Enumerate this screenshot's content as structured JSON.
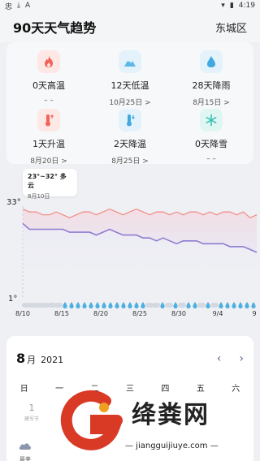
{
  "status": {
    "time": "4:19"
  },
  "header": {
    "title": "90天天气趋势",
    "city": "东城区"
  },
  "stats": [
    {
      "label": "0天高温",
      "date": "– –",
      "icon": "flame-icon",
      "color": "#f0645a",
      "bg": "#fde8e6"
    },
    {
      "label": "12天低温",
      "date": "10月25日 >",
      "icon": "snow-mountain-icon",
      "color": "#5db7e8",
      "bg": "#e3f2fb"
    },
    {
      "label": "28天降雨",
      "date": "8月15日 >",
      "icon": "raindrop-icon",
      "color": "#42a8e0",
      "bg": "#e3f2fb"
    },
    {
      "label": "1天升温",
      "date": "8月20日 >",
      "icon": "thermometer-up-icon",
      "color": "#f0645a",
      "bg": "#fde8e6"
    },
    {
      "label": "2天降温",
      "date": "8月25日 >",
      "icon": "thermometer-down-icon",
      "color": "#42a8e0",
      "bg": "#e3f2fb"
    },
    {
      "label": "0天降雪",
      "date": "– –",
      "icon": "snowflake-icon",
      "color": "#3cc0b4",
      "bg": "#e0f6f3"
    }
  ],
  "tooltip": {
    "range": "23°~32° 多云",
    "date": "8月10日"
  },
  "chart_data": {
    "type": "line",
    "ymax_label": "33°",
    "ymin_label": "1°",
    "x_labels": [
      "8/10",
      "8/15",
      "8/20",
      "8/25",
      "8/30",
      "9/4",
      "9"
    ],
    "series": [
      {
        "values": [
          32,
          31,
          31,
          30,
          30,
          31,
          30,
          29,
          30,
          31,
          31,
          30,
          31,
          32,
          31,
          30,
          31,
          32,
          31,
          30,
          31,
          31,
          30,
          31,
          30,
          31,
          31,
          30,
          31,
          30,
          31,
          31,
          30,
          31,
          29,
          30
        ]
      },
      {
        "values": [
          27,
          25,
          25,
          25,
          25,
          25,
          25,
          24,
          24,
          24,
          24,
          23,
          24,
          25,
          24,
          23,
          23,
          23,
          22,
          22,
          21,
          22,
          21,
          20,
          21,
          21,
          21,
          20,
          20,
          20,
          20,
          19,
          19,
          19,
          18,
          17
        ]
      }
    ],
    "colors": {
      "high": "#f08a85",
      "low": "#8f7bd0"
    }
  },
  "calendar": {
    "month": "8",
    "month_unit": "月",
    "year": "2021",
    "prev": "‹",
    "next": "›",
    "weekdays": [
      "日",
      "一",
      "二",
      "三",
      "四",
      "五",
      "六"
    ],
    "day1": "1",
    "day1_sub": "建军节",
    "best_label": "最美"
  },
  "watermark": {
    "text": "绛粪网",
    "sub": "— jiangguijiuye.com —"
  }
}
